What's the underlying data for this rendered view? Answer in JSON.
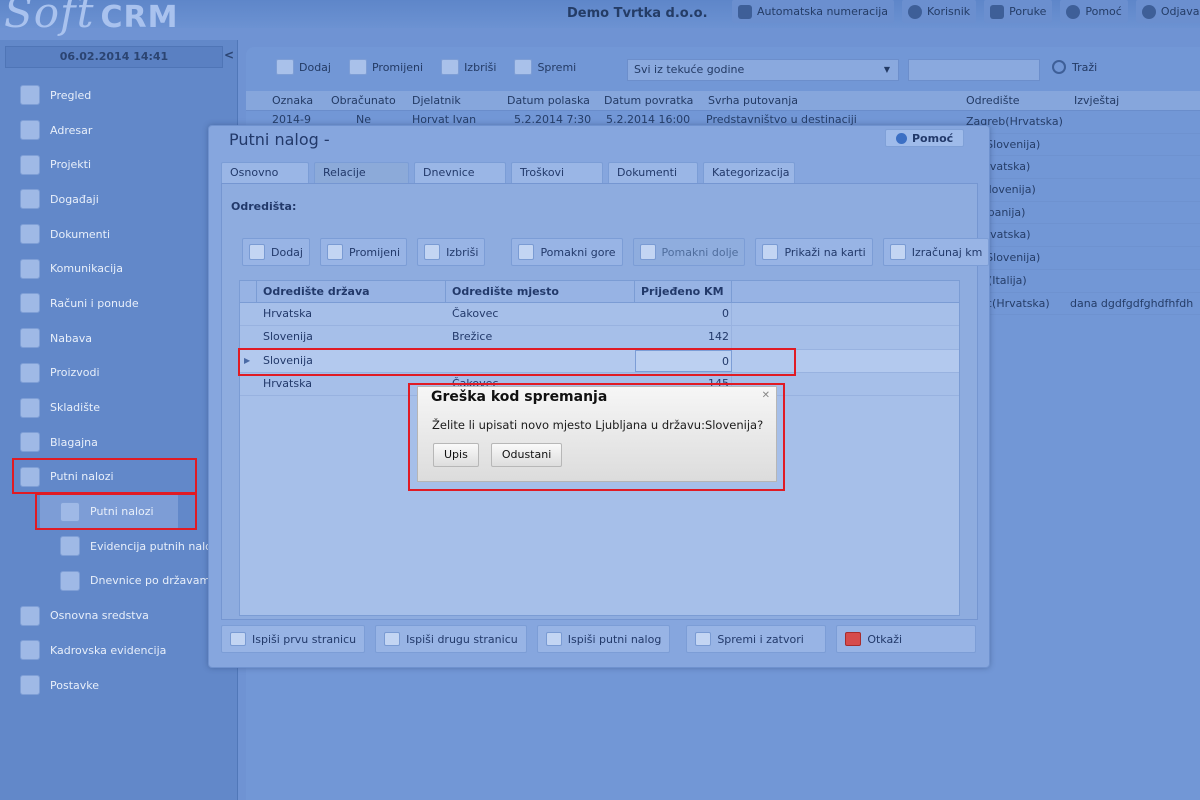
{
  "app": {
    "logo_text": "Soft",
    "logo_bold": "CRM",
    "company": "Demo Tvrtka d.o.o.",
    "top_links": [
      "Automatska numeracija",
      "Korisnik",
      "Poruke",
      "Pomoć",
      "Odjava"
    ]
  },
  "sidebar": {
    "datetime": "06.02.2014 14:41",
    "collapse": "<",
    "items": [
      {
        "label": "Pregled",
        "icon": "overview-icon"
      },
      {
        "label": "Adresar",
        "icon": "address-book-icon"
      },
      {
        "label": "Projekti",
        "icon": "projects-icon"
      },
      {
        "label": "Događaji",
        "icon": "events-icon"
      },
      {
        "label": "Dokumenti",
        "icon": "documents-icon"
      },
      {
        "label": "Komunikacija",
        "icon": "communication-icon"
      },
      {
        "label": "Računi i ponude",
        "icon": "invoices-icon"
      },
      {
        "label": "Nabava",
        "icon": "procurement-icon"
      },
      {
        "label": "Proizvodi",
        "icon": "products-icon"
      },
      {
        "label": "Skladište",
        "icon": "warehouse-icon"
      },
      {
        "label": "Blagajna",
        "icon": "cash-register-icon"
      },
      {
        "label": "Putni nalozi",
        "icon": "travel-orders-icon"
      }
    ],
    "sub_items": [
      "Putni nalozi",
      "Evidencija putnih nalog",
      "Dnevnice po državama"
    ],
    "bottom_items": [
      "Osnovna sredstva",
      "Kadrovska evidencija",
      "Postavke"
    ]
  },
  "main": {
    "toolbar": [
      "Dodaj",
      "Promijeni",
      "Izbriši",
      "Spremi"
    ],
    "filter_value": "Svi iz tekuće godine",
    "search_label": "Traži",
    "columns": [
      "Oznaka",
      "Obračunato",
      "Djelatnik",
      "Datum polaska",
      "Datum povratka",
      "Svrha putovanja",
      "Odredište",
      "Izvještaj"
    ],
    "first_row": [
      "2014-9",
      "Ne",
      "Horvat Ivan",
      "5.2.2014 7:30",
      "5.2.2014 16:00",
      "Predstavništvo u destinaciji"
    ],
    "visible_right": [
      [
        "Zagreb(Hrvatska)",
        ""
      ],
      [
        "ice(Slovenija)",
        ""
      ],
      [
        "a(Hrvatska)",
        ""
      ],
      [
        "er(Slovenija)",
        ""
      ],
      [
        "a(Albanija)",
        ""
      ],
      [
        "g(Hrvatska)",
        ""
      ],
      [
        "ice(Slovenija)",
        ""
      ],
      [
        "ALO(Italija)",
        ""
      ],
      [
        "ovec(Hrvatska)",
        "dana dgdfgdfghdfhfdh"
      ]
    ]
  },
  "modal": {
    "title": "Putni nalog -",
    "help": "Pomoć",
    "tabs": [
      "Osnovno",
      "Relacije",
      "Dnevnice",
      "Troškovi",
      "Dokumenti",
      "Kategorizacija"
    ],
    "section": "Odredišta:",
    "toolbar": [
      "Dodaj",
      "Promijeni",
      "Izbriši",
      "Pomakni gore",
      "Pomakni dolje",
      "Prikaži na karti",
      "Izračunaj km"
    ],
    "grid_columns": [
      "Odredište država",
      "Odredište mjesto",
      "Prijeđeno KM"
    ],
    "rows": [
      [
        "Hrvatska",
        "Čakovec",
        "0"
      ],
      [
        "Slovenija",
        "Brežice",
        "142"
      ],
      [
        "Slovenija",
        "",
        "0"
      ],
      [
        "Hrvatska",
        "Čakovec",
        "145"
      ]
    ],
    "footer": [
      "Ispiši prvu stranicu",
      "Ispiši drugu stranicu",
      "Ispiši putni nalog",
      "Spremi i zatvori",
      "Otkaži"
    ]
  },
  "alert": {
    "title": "Greška kod spremanja",
    "message": "Želite li upisati novo mjesto Ljubljana u državu:Slovenija?",
    "ok": "Upis",
    "cancel": "Odustani",
    "close": "✕"
  },
  "colors": {
    "highlight": "#e01b24",
    "overlay_blue": "#6f93d3"
  }
}
